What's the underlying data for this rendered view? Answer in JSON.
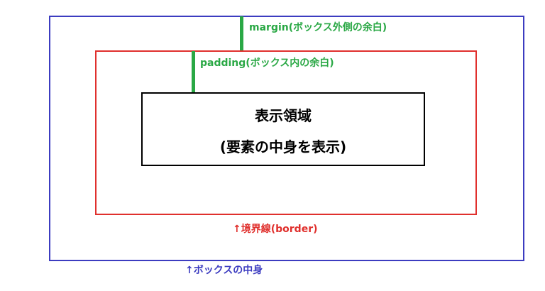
{
  "diagram": {
    "margin_label": "margin(ボックス外側の余白)",
    "padding_label": "padding(ボックス内の余白)",
    "content_title": "表示領域",
    "content_subtitle": "(要素の中身を表示)",
    "border_label": "↑境界線(border)",
    "box_inner_label": "↑ボックスの中身"
  },
  "colors": {
    "outer_box": "#3c3cc0",
    "border_box": "#e0302d",
    "content_box": "#000000",
    "indicator": "#2aa845"
  }
}
